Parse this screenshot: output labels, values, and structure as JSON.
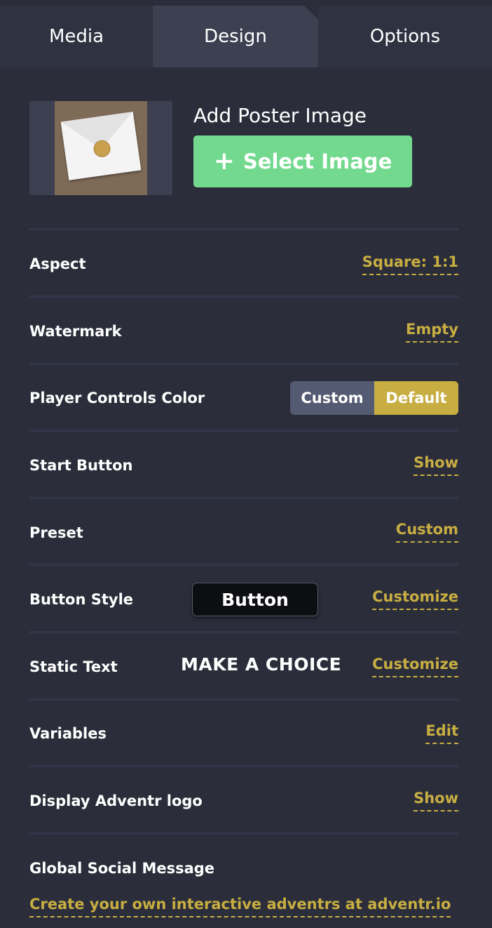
{
  "tabs": [
    {
      "label": "Media"
    },
    {
      "label": "Design"
    },
    {
      "label": "Options"
    }
  ],
  "poster": {
    "title": "Add Poster Image",
    "button_label": "Select Image",
    "button_icon": "plus-icon"
  },
  "rows": {
    "aspect": {
      "label": "Aspect",
      "value": "Square: 1:1"
    },
    "watermark": {
      "label": "Watermark",
      "value": "Empty"
    },
    "player_controls_color": {
      "label": "Player Controls Color",
      "options": [
        "Custom",
        "Default"
      ],
      "selected": "Default"
    },
    "start_button": {
      "label": "Start Button",
      "value": "Show"
    },
    "preset": {
      "label": "Preset",
      "value": "Custom"
    },
    "button_style": {
      "label": "Button Style",
      "preview": "Button",
      "action": "Customize"
    },
    "static_text": {
      "label": "Static Text",
      "preview": "MAKE A CHOICE",
      "action": "Customize"
    },
    "variables": {
      "label": "Variables",
      "value": "Edit"
    },
    "display_logo": {
      "label": "Display Adventr logo",
      "value": "Show"
    },
    "global_social": {
      "label": "Global Social Message",
      "value": "Create your own interactive adventrs at adventr.io"
    }
  },
  "colors": {
    "background": "#2b2e3a",
    "accent_gold": "#c8ae42",
    "accent_green": "#72d98e",
    "tab_active": "#3c4051"
  }
}
